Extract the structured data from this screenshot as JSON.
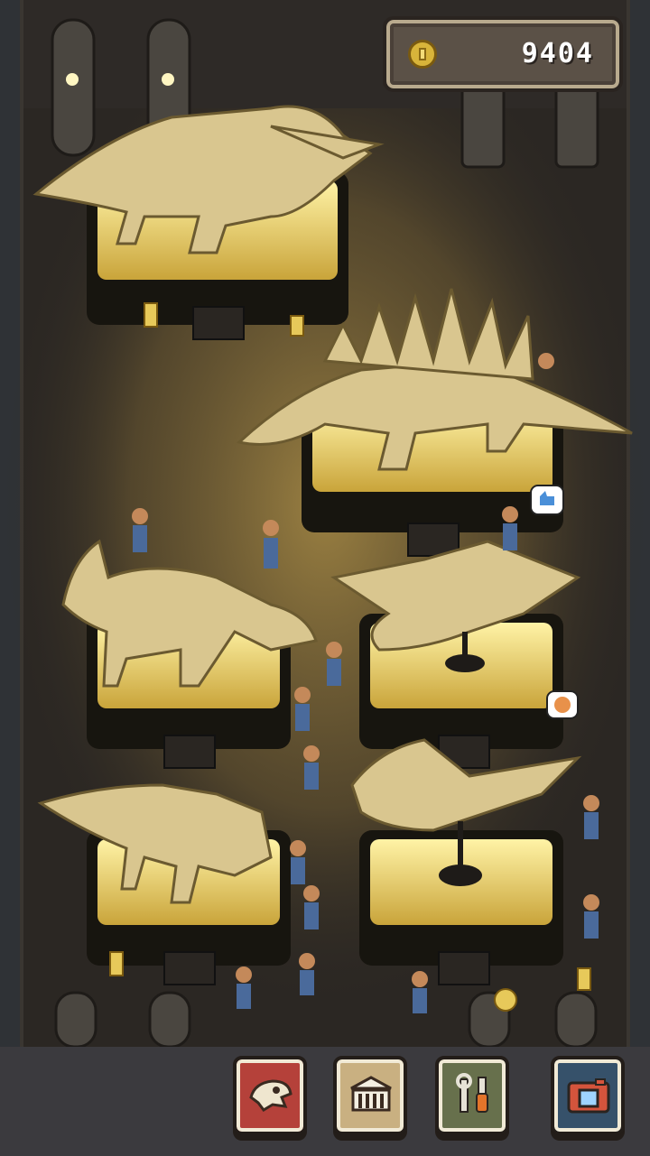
{
  "hud": {
    "coins": "9404",
    "coin_icon": "coin-icon"
  },
  "toolbar": {
    "buttons": [
      {
        "name": "fossils-button",
        "icon": "dino-skull-icon"
      },
      {
        "name": "museum-button",
        "icon": "museum-building-icon"
      },
      {
        "name": "tools-button",
        "icon": "wrench-screwdriver-icon"
      },
      {
        "name": "camera-button",
        "icon": "camera-icon"
      }
    ]
  },
  "scene": {
    "exhibits": [
      "triceratops-skeleton",
      "stegosaurus-skeleton",
      "ankylosaurus-skeleton",
      "pteranodon-skeleton",
      "styracosaurus-skeleton",
      "pterodactyl-skeleton"
    ],
    "speech_bubbles": [
      "thumbs-up-icon",
      "happy-face-icon"
    ]
  },
  "colors": {
    "floor": "#2b2723",
    "light_pool": "#8a6f35",
    "bone": "#d9c68f",
    "pedestal_top": "#e7c95a",
    "accent_red": "#b5413a"
  }
}
